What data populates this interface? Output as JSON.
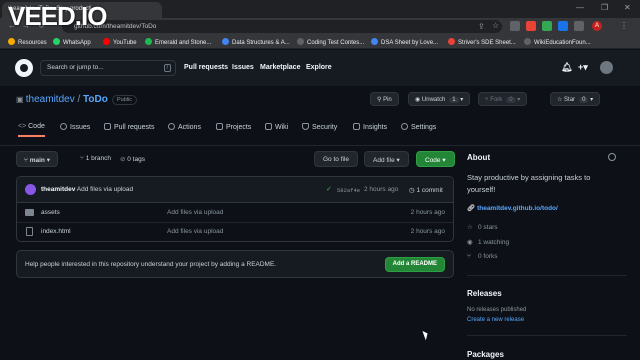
{
  "watermark": "VEED.IO",
  "browser": {
    "tab_title": "theamitdev/ToDo: Stay producti...",
    "url": "github.com/theamitdev/ToDo",
    "bookmarks": [
      "Resources",
      "WhatsApp",
      "YouTube",
      "Emerald and Stone...",
      "Data Structures & A...",
      "Coding Test Contes...",
      "DSA Sheet by Love...",
      "Striver's SDE Sheet...",
      "WikiEducationFoun..."
    ],
    "bookmark_colors": [
      "#f9ab00",
      "#25d366",
      "#ff0000",
      "#1db954",
      "#4285f4",
      "#5f6368",
      "#4285f4",
      "#ea4335",
      "#5f6368"
    ],
    "profile_initial": "A"
  },
  "header": {
    "search_placeholder": "Search or jump to...",
    "search_key": "/",
    "nav": [
      "Pull requests",
      "Issues",
      "Marketplace",
      "Explore"
    ]
  },
  "repo": {
    "owner": "theamitdev",
    "separator": "/",
    "name": "ToDo",
    "visibility": "Public",
    "pin_label": "Pin",
    "unwatch_label": "Unwatch",
    "unwatch_count": "1",
    "fork_label": "Fork",
    "fork_count": "0",
    "star_label": "Star",
    "star_count": "0",
    "tabs": [
      "Code",
      "Issues",
      "Pull requests",
      "Actions",
      "Projects",
      "Wiki",
      "Security",
      "Insights",
      "Settings"
    ]
  },
  "toolbar": {
    "branch": "main",
    "branch_count": "1 branch",
    "tag_count": "0 tags",
    "goto_file": "Go to file",
    "add_file": "Add file",
    "code": "Code"
  },
  "commit": {
    "author": "theamitdev",
    "message": "Add files via upload",
    "sha": "582af4e",
    "time": "2 hours ago",
    "count": "1 commit"
  },
  "files": [
    {
      "name": "assets",
      "type": "folder",
      "message": "Add files via upload",
      "date": "2 hours ago"
    },
    {
      "name": "index.html",
      "type": "file",
      "message": "Add files via upload",
      "date": "2 hours ago"
    }
  ],
  "readme": {
    "text": "Help people interested in this repository understand your project by adding a README.",
    "button": "Add a README"
  },
  "about": {
    "heading": "About",
    "description": "Stay productive by assigning tasks to yourself!",
    "link": "theamitdev.github.io/todo/",
    "stars": "0 stars",
    "watching": "1 watching",
    "forks": "0 forks"
  },
  "releases": {
    "heading": "Releases",
    "none": "No releases published",
    "create": "Create a new release"
  },
  "packages": {
    "heading": "Packages"
  }
}
